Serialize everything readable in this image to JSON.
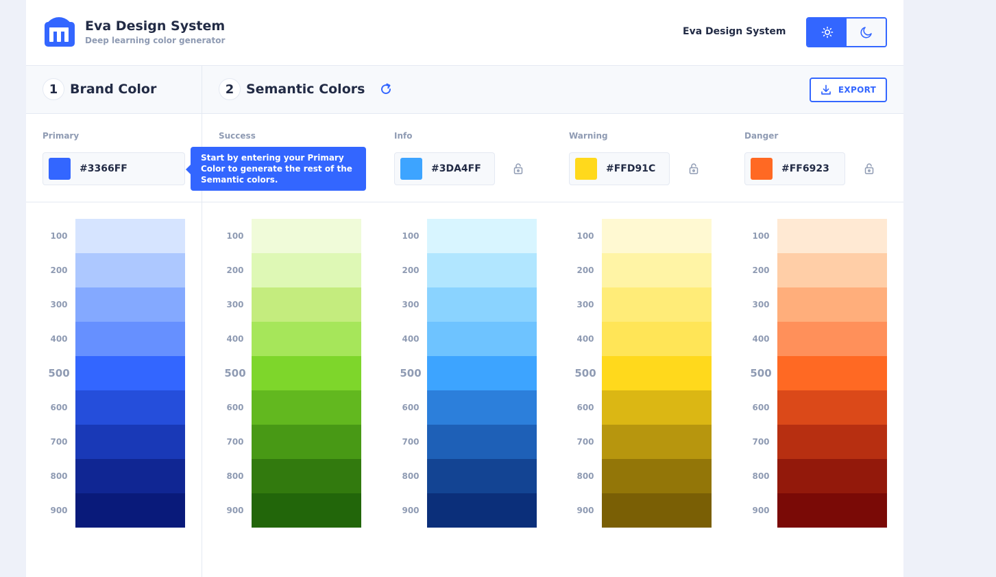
{
  "header": {
    "title": "Eva Design System",
    "subtitle": "Deep learning color generator",
    "link": "Eva Design System"
  },
  "sections": {
    "brand": {
      "number": "1",
      "label": "Brand Color"
    },
    "semantic": {
      "number": "2",
      "label": "Semantic Colors"
    },
    "export_label": "EXPORT"
  },
  "fields": {
    "primary": {
      "label": "Primary",
      "value": "#3366FF"
    },
    "success": {
      "label": "Success"
    },
    "info": {
      "label": "Info",
      "value": "#3DA4FF"
    },
    "warning": {
      "label": "Warning",
      "value": "#FFD91C"
    },
    "danger": {
      "label": "Danger",
      "value": "#FF6923"
    }
  },
  "tooltip": "Start by entering your Primary Color to generate the rest of the Semantic colors.",
  "shade_labels": [
    "100",
    "200",
    "300",
    "400",
    "500",
    "600",
    "700",
    "800",
    "900"
  ],
  "palettes": [
    {
      "name": "primary",
      "colors": [
        "#D6E4FF",
        "#ADC8FF",
        "#84A9FF",
        "#6690FF",
        "#3366FF",
        "#254EDB",
        "#1939B7",
        "#102693",
        "#091A7A"
      ]
    },
    {
      "name": "success",
      "colors": [
        "#F0FBD9",
        "#DEF8B5",
        "#C4EC7E",
        "#A6E65A",
        "#7ED62B",
        "#62B81F",
        "#489915",
        "#327A0E",
        "#22660A"
      ]
    },
    {
      "name": "info",
      "colors": [
        "#D8F5FF",
        "#B1E6FF",
        "#8AD3FF",
        "#6EC3FF",
        "#3DA4FF",
        "#2C7FDB",
        "#1E60B7",
        "#134493",
        "#0B2F7A"
      ]
    },
    {
      "name": "warning",
      "colors": [
        "#FFF9D2",
        "#FFF4A5",
        "#FFEC78",
        "#FFE557",
        "#FFD91C",
        "#DBB714",
        "#B7960E",
        "#937608",
        "#7A5F05"
      ]
    },
    {
      "name": "danger",
      "colors": [
        "#FFE9D3",
        "#FFCEA7",
        "#FFAE7B",
        "#FF905A",
        "#FF6923",
        "#DB4919",
        "#B72F11",
        "#93190B",
        "#7A0A06"
      ]
    }
  ],
  "icons": {
    "logo": "eva-logo-icon",
    "light_mode": "sun-icon",
    "dark_mode": "moon-icon",
    "refresh": "refresh-icon",
    "export": "download-icon",
    "lock": "lock-icon"
  },
  "colors": {
    "accent": "#3366FF",
    "text": "#222B45",
    "hint": "#8F9BB3"
  }
}
